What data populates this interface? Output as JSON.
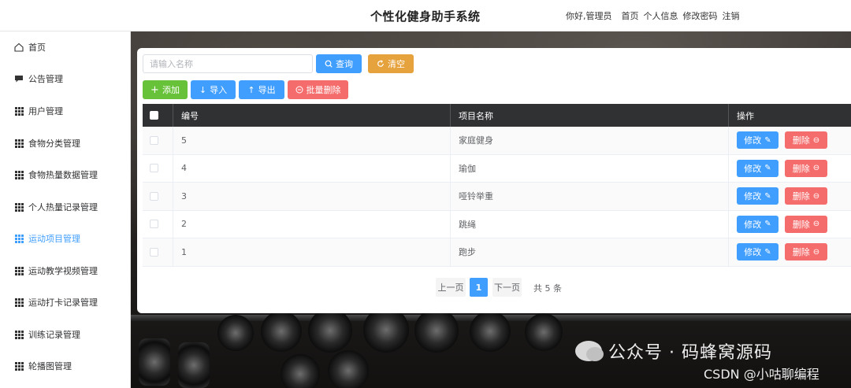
{
  "header": {
    "title": "个性化健身助手系统",
    "greeting": "你好,管理员",
    "nav": [
      "首页",
      "个人信息",
      "修改密码",
      "注销"
    ]
  },
  "sidebar": {
    "items": [
      {
        "label": "首页",
        "icon": "home-icon",
        "active": false
      },
      {
        "label": "公告管理",
        "icon": "chat-icon",
        "active": false
      },
      {
        "label": "用户管理",
        "icon": "grid-icon",
        "active": false
      },
      {
        "label": "食物分类管理",
        "icon": "grid-icon",
        "active": false
      },
      {
        "label": "食物热量数据管理",
        "icon": "grid-icon",
        "active": false
      },
      {
        "label": "个人热量记录管理",
        "icon": "grid-icon",
        "active": false
      },
      {
        "label": "运动项目管理",
        "icon": "grid-icon",
        "active": true
      },
      {
        "label": "运动教学视频管理",
        "icon": "grid-icon",
        "active": false
      },
      {
        "label": "运动打卡记录管理",
        "icon": "grid-icon",
        "active": false
      },
      {
        "label": "训练记录管理",
        "icon": "grid-icon",
        "active": false
      },
      {
        "label": "轮播图管理",
        "icon": "grid-icon",
        "active": false
      }
    ]
  },
  "search": {
    "placeholder": "请输入名称",
    "value": "",
    "query_label": "查询",
    "clear_label": "清空"
  },
  "toolbar": {
    "add_label": "添加",
    "import_label": "导入",
    "export_label": "导出",
    "batch_delete_label": "批量删除"
  },
  "table": {
    "columns": [
      "编号",
      "项目名称",
      "操作"
    ],
    "rows": [
      {
        "id": "5",
        "name": "家庭健身"
      },
      {
        "id": "4",
        "name": "瑜伽"
      },
      {
        "id": "3",
        "name": "哑铃举重"
      },
      {
        "id": "2",
        "name": "跳绳"
      },
      {
        "id": "1",
        "name": "跑步"
      }
    ],
    "edit_label": "修改",
    "delete_label": "删除"
  },
  "pagination": {
    "prev_label": "上一页",
    "current_page": "1",
    "next_label": "下一页",
    "total_label": "共 5 条"
  },
  "watermark": {
    "line1": "公众号 · 码蜂窝源码",
    "line2": "CSDN @小咕聊编程"
  },
  "colors": {
    "primary": "#409eff",
    "success": "#67c23a",
    "warning": "#e6a23c",
    "danger": "#f56c6c",
    "table_header": "#303133"
  }
}
